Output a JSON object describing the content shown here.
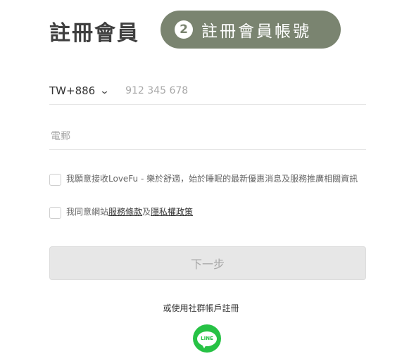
{
  "header": {
    "title": "註冊會員",
    "step_number": "2",
    "step_label": "註冊會員帳號"
  },
  "form": {
    "country_code": "TW+886",
    "phone_placeholder": "912 345 678",
    "email_placeholder": "電郵",
    "consent_marketing": "我願意接收LoveFu - 樂於舒適，始於睡眠的最新優惠消息及服務推廣相關資訊",
    "consent_terms_prefix": "我同意網站",
    "terms_link": "服務條款",
    "consent_terms_join": "及",
    "privacy_link": "隱私權政策",
    "next_button": "下一步"
  },
  "social": {
    "label": "或使用社群帳戶註冊",
    "line_text": "LINE"
  },
  "colors": {
    "pill": "#7a8470",
    "line_green": "#27c245",
    "button_disabled": "#e7e7e7"
  }
}
